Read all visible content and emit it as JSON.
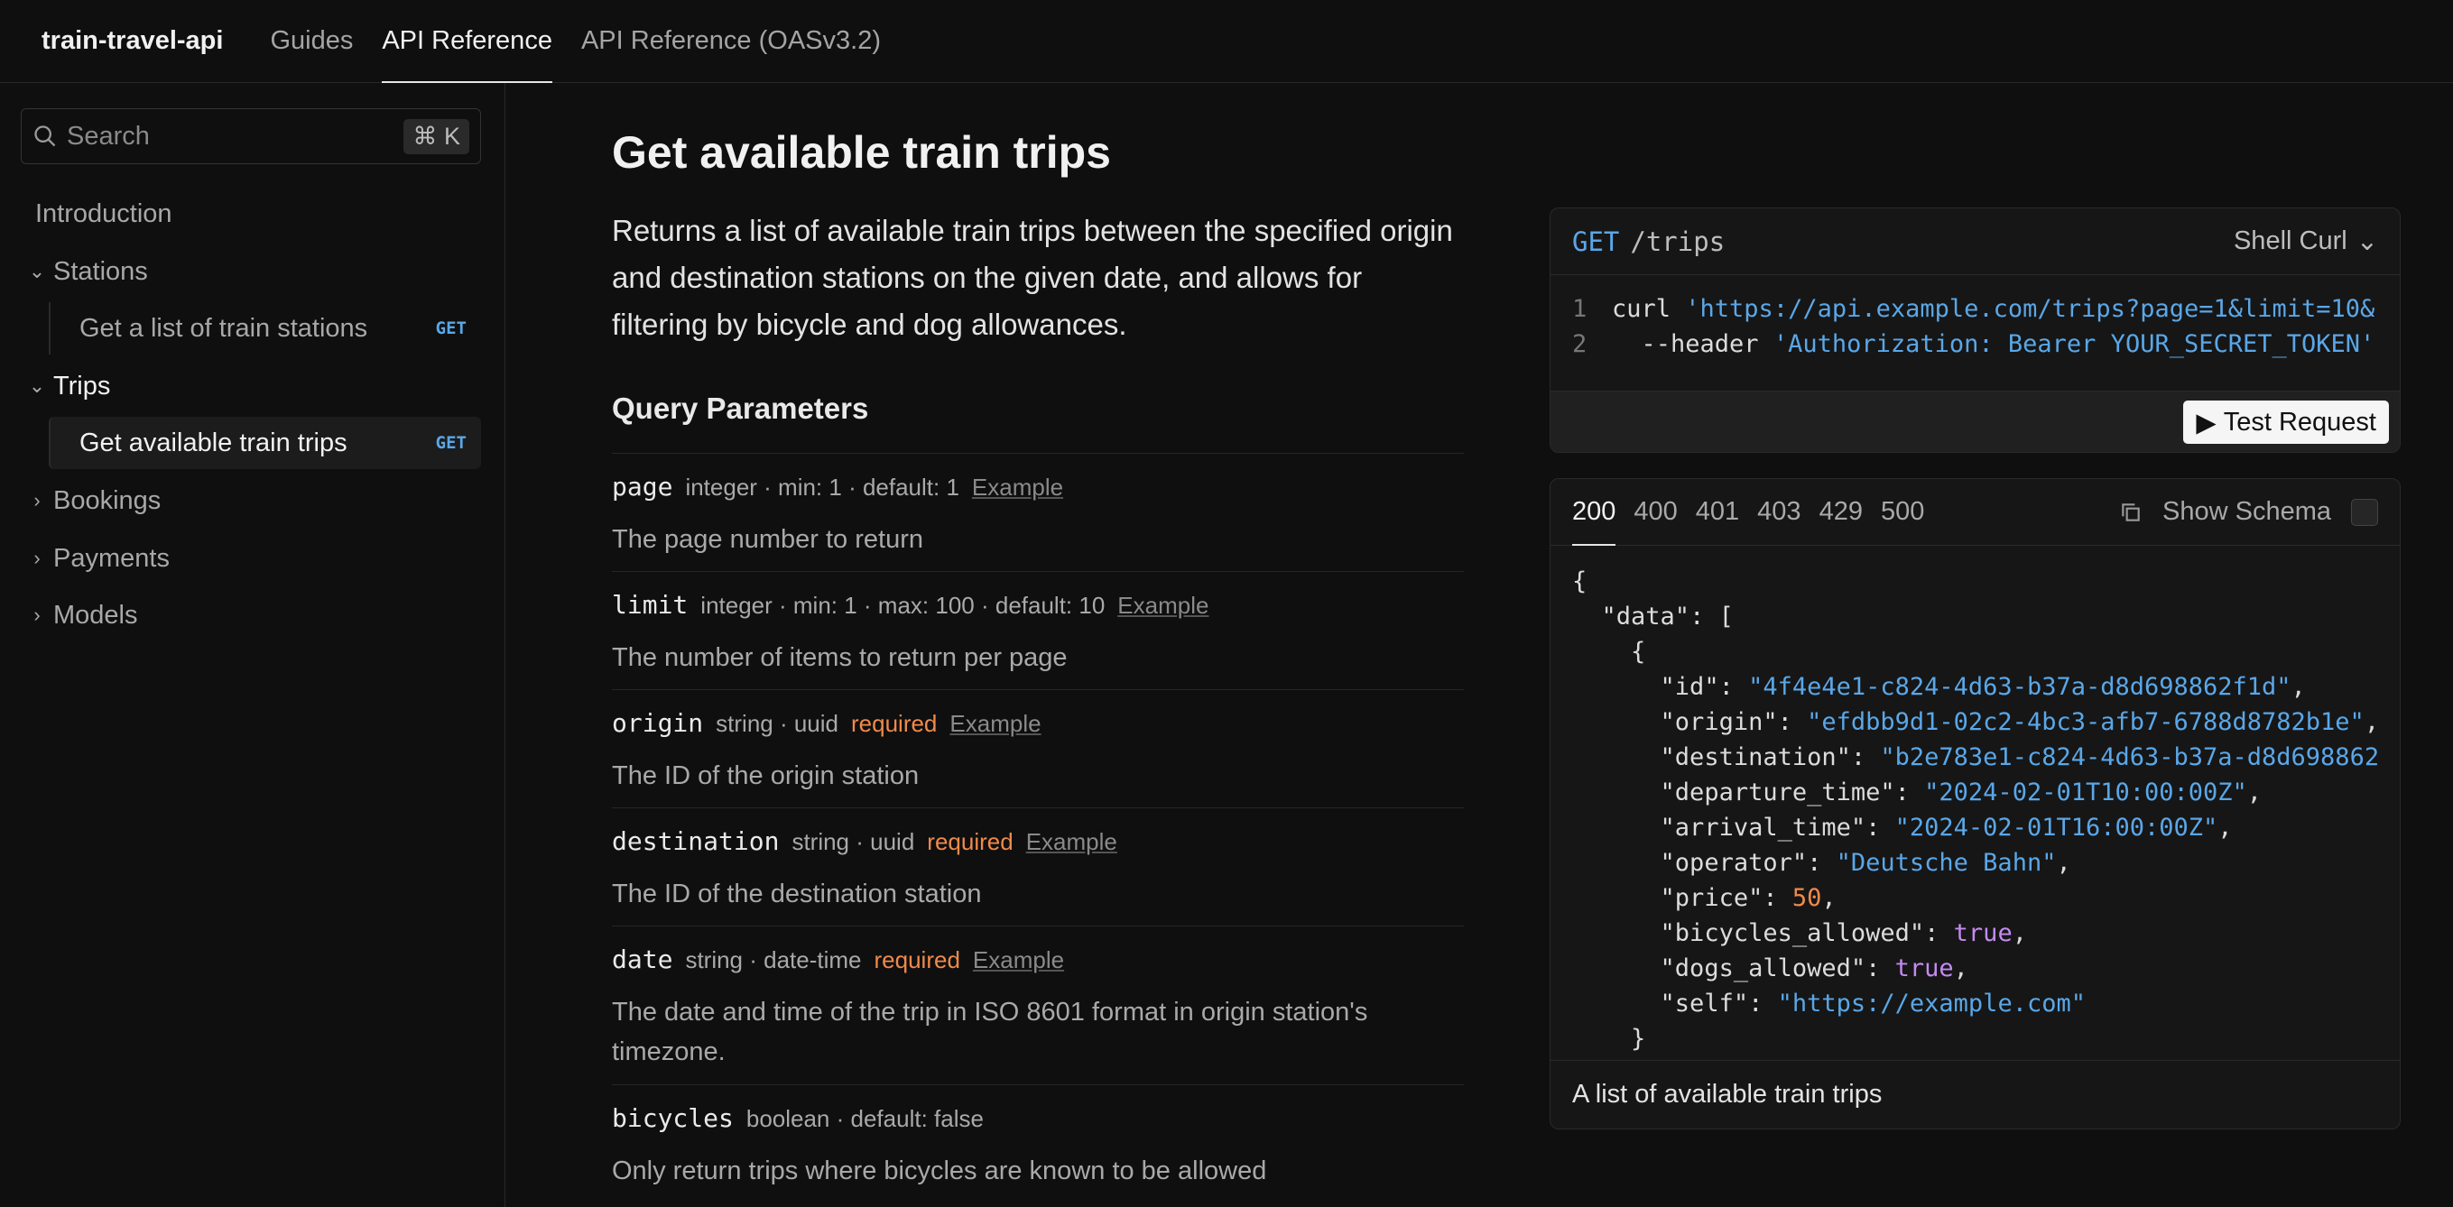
{
  "header": {
    "brand": "train-travel-api",
    "tabs": [
      {
        "label": "Guides",
        "active": false
      },
      {
        "label": "API Reference",
        "active": true
      },
      {
        "label": "API Reference (OASv3.2)",
        "active": false
      }
    ]
  },
  "sidebar": {
    "search": {
      "placeholder": "Search",
      "shortcut": "⌘ K"
    },
    "items": [
      {
        "label": "Introduction"
      },
      {
        "label": "Stations",
        "expanded": true
      },
      {
        "label": "Get a list of train stations",
        "method": "GET"
      },
      {
        "label": "Trips",
        "expanded": true
      },
      {
        "label": "Get available train trips",
        "method": "GET",
        "selected": true
      },
      {
        "label": "Bookings",
        "expanded": false
      },
      {
        "label": "Payments",
        "expanded": false
      },
      {
        "label": "Models",
        "expanded": false
      }
    ]
  },
  "main": {
    "title": "Get available train trips",
    "description": "Returns a list of available train trips between the specified origin and destination stations on the given date, and allows for filtering by bicycle and dog allowances.",
    "query_heading": "Query Parameters",
    "params": [
      {
        "name": "page",
        "meta": "integer · min:  1 · default: 1",
        "required": "",
        "example": "Example",
        "description": "The page number to return"
      },
      {
        "name": "limit",
        "meta": "integer · min:  1 · max:  100 · default: 10",
        "required": "",
        "example": "Example",
        "description": "The number of items to return per page"
      },
      {
        "name": "origin",
        "meta": "string · uuid",
        "required": "required",
        "example": "Example",
        "description": "The ID of the origin station"
      },
      {
        "name": "destination",
        "meta": "string · uuid",
        "required": "required",
        "example": "Example",
        "description": "The ID of the destination station"
      },
      {
        "name": "date",
        "meta": "string · date-time",
        "required": "required",
        "example": "Example",
        "description": "The date and time of the trip in ISO 8601 format in origin station's timezone."
      },
      {
        "name": "bicycles",
        "meta": "boolean · default: false",
        "required": "",
        "example": "",
        "description": "Only return trips where bicycles are known to be allowed"
      }
    ]
  },
  "request": {
    "method": "GET",
    "path": "/trips",
    "language": "Shell Curl",
    "code_lines": [
      {
        "n": "1",
        "cmd": "curl ",
        "str": "'https://api.example.com/trips?page=1&limit=10&"
      },
      {
        "n": "2",
        "cmd": "  --header ",
        "str": "'Authorization: Bearer YOUR_SECRET_TOKEN'"
      }
    ],
    "test_label": "Test Request"
  },
  "response": {
    "codes": [
      "200",
      "400",
      "401",
      "403",
      "429",
      "500"
    ],
    "active_code": "200",
    "show_schema": "Show Schema",
    "json": {
      "open": "{",
      "data_key": "\"data\"",
      "item_open": "{",
      "fields": [
        {
          "key": "\"id\"",
          "value": "\"4f4e4e1-c824-4d63-b37a-d8d698862f1d\"",
          "kind": "str"
        },
        {
          "key": "\"origin\"",
          "value": "\"efdbb9d1-02c2-4bc3-afb7-6788d8782b1e\"",
          "kind": "str"
        },
        {
          "key": "\"destination\"",
          "value": "\"b2e783e1-c824-4d63-b37a-d8d698862",
          "kind": "str"
        },
        {
          "key": "\"departure_time\"",
          "value": "\"2024-02-01T10:00:00Z\"",
          "kind": "str"
        },
        {
          "key": "\"arrival_time\"",
          "value": "\"2024-02-01T16:00:00Z\"",
          "kind": "str"
        },
        {
          "key": "\"operator\"",
          "value": "\"Deutsche Bahn\"",
          "kind": "str"
        },
        {
          "key": "\"price\"",
          "value": "50",
          "kind": "num"
        },
        {
          "key": "\"bicycles_allowed\"",
          "value": "true",
          "kind": "bool"
        },
        {
          "key": "\"dogs_allowed\"",
          "value": "true",
          "kind": "bool"
        },
        {
          "key": "\"self\"",
          "value": "\"https://example.com\"",
          "kind": "str"
        }
      ],
      "item_close": "}"
    },
    "footer": "A list of available train trips"
  },
  "colors": {
    "accent": "#5aa7e8",
    "required": "#f08a4b",
    "boolean": "#c38bf0",
    "background": "#0f0f0f"
  }
}
